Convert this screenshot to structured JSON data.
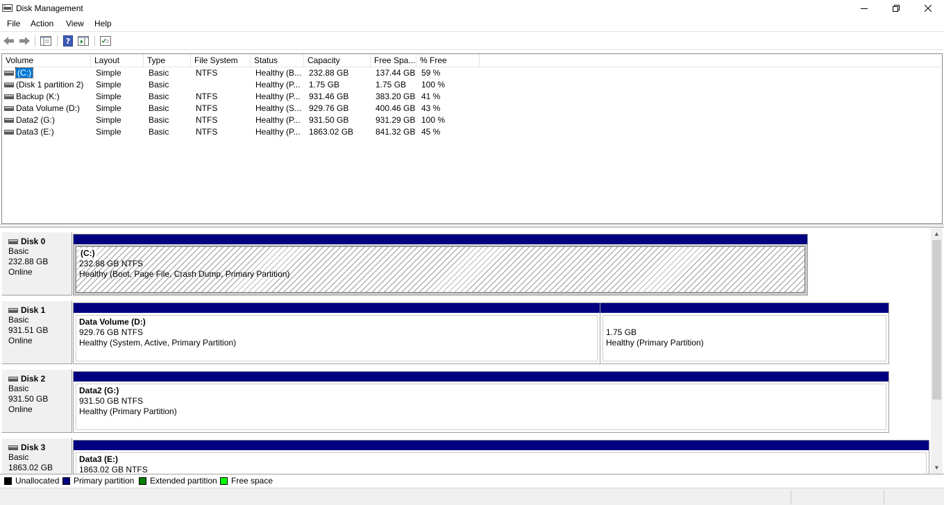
{
  "window": {
    "title": "Disk Management"
  },
  "menu": [
    "File",
    "Action",
    "View",
    "Help"
  ],
  "toolbar": {
    "icons": [
      "back-arrow-icon",
      "forward-arrow-icon",
      "console-tree-icon",
      "help-icon",
      "show-action-pane-icon",
      "properties-icon"
    ]
  },
  "volume_list": {
    "columns": [
      "Volume",
      "Layout",
      "Type",
      "File System",
      "Status",
      "Capacity",
      "Free Spa...",
      "% Free"
    ],
    "rows": [
      {
        "volume": "(C:)",
        "layout": "Simple",
        "type": "Basic",
        "fs": "NTFS",
        "status": "Healthy (B...",
        "capacity": "232.88 GB",
        "free": "137.44 GB",
        "pct": "59 %"
      },
      {
        "volume": "(Disk 1 partition 2)",
        "layout": "Simple",
        "type": "Basic",
        "fs": "",
        "status": "Healthy (P...",
        "capacity": "1.75 GB",
        "free": "1.75 GB",
        "pct": "100 %"
      },
      {
        "volume": "Backup (K:)",
        "layout": "Simple",
        "type": "Basic",
        "fs": "NTFS",
        "status": "Healthy (P...",
        "capacity": "931.46 GB",
        "free": "383.20 GB",
        "pct": "41 %"
      },
      {
        "volume": "Data Volume (D:)",
        "layout": "Simple",
        "type": "Basic",
        "fs": "NTFS",
        "status": "Healthy (S...",
        "capacity": "929.76 GB",
        "free": "400.46 GB",
        "pct": "43 %"
      },
      {
        "volume": "Data2 (G:)",
        "layout": "Simple",
        "type": "Basic",
        "fs": "NTFS",
        "status": "Healthy (P...",
        "capacity": "931.50 GB",
        "free": "931.29 GB",
        "pct": "100 %"
      },
      {
        "volume": "Data3 (E:)",
        "layout": "Simple",
        "type": "Basic",
        "fs": "NTFS",
        "status": "Healthy (P...",
        "capacity": "1863.02 GB",
        "free": "841.32 GB",
        "pct": "45 %"
      }
    ]
  },
  "disks": [
    {
      "name": "Disk 0",
      "type": "Basic",
      "size": "232.88 GB",
      "state": "Online",
      "partitions": [
        {
          "name": "(C:)",
          "size": "232.88 GB NTFS",
          "status": "Healthy (Boot, Page File, Crash Dump, Primary Partition)"
        }
      ]
    },
    {
      "name": "Disk 1",
      "type": "Basic",
      "size": "931.51 GB",
      "state": "Online",
      "partitions": [
        {
          "name": "Data Volume  (D:)",
          "size": "929.76 GB NTFS",
          "status": "Healthy (System, Active, Primary Partition)"
        },
        {
          "name": "",
          "size": "1.75 GB",
          "status": "Healthy (Primary Partition)"
        }
      ]
    },
    {
      "name": "Disk 2",
      "type": "Basic",
      "size": "931.50 GB",
      "state": "Online",
      "partitions": [
        {
          "name": "Data2  (G:)",
          "size": "931.50 GB NTFS",
          "status": "Healthy (Primary Partition)"
        }
      ]
    },
    {
      "name": "Disk 3",
      "type": "Basic",
      "size": "1863.02 GB",
      "state": "",
      "partitions": [
        {
          "name": "Data3  (E:)",
          "size": "1863.02 GB NTFS",
          "status": ""
        }
      ]
    }
  ],
  "legend": [
    {
      "label": "Unallocated",
      "color": "#000000"
    },
    {
      "label": "Primary partition",
      "color": "#000080"
    },
    {
      "label": "Extended partition",
      "color": "#008000"
    },
    {
      "label": "Free space",
      "color": "#00ff00"
    }
  ],
  "colors": {
    "partition_bar": "#000080",
    "selection": "#0078d7"
  }
}
